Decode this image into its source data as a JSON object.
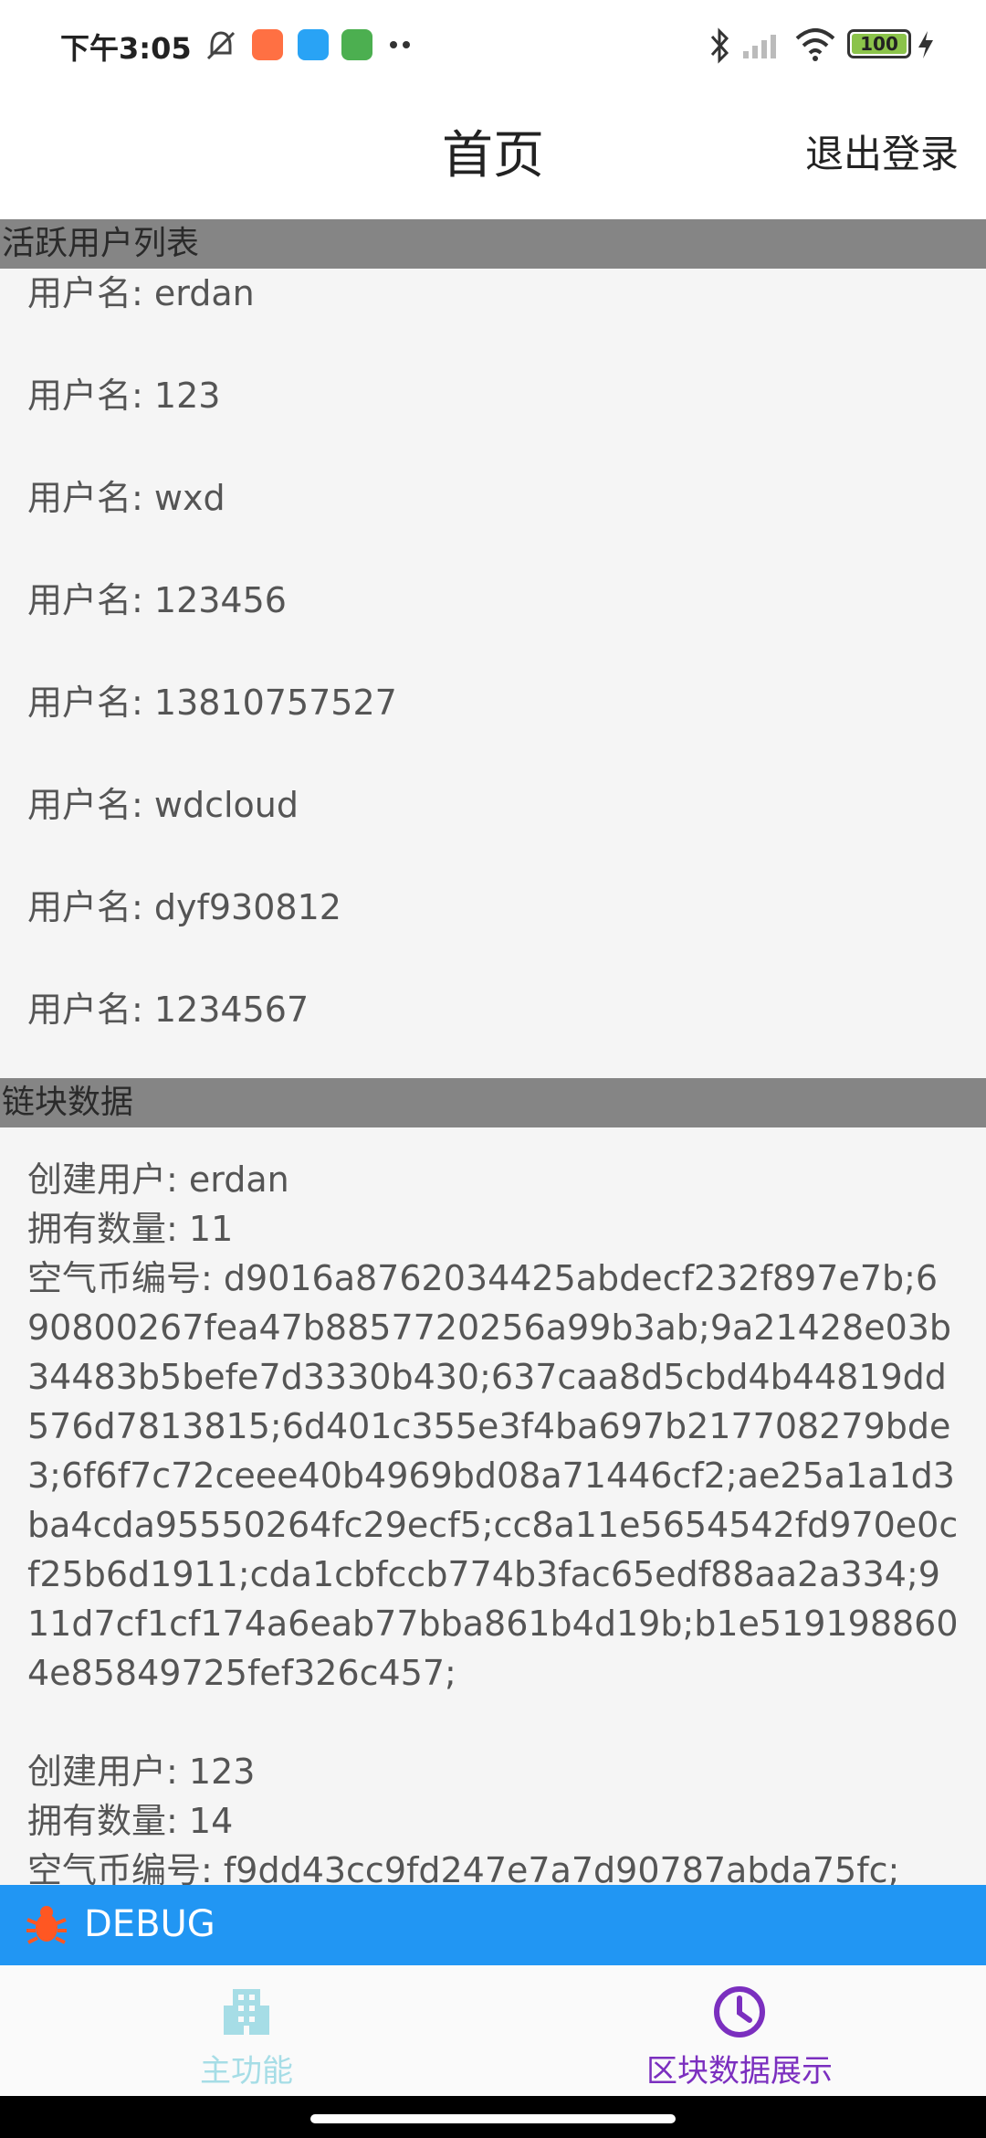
{
  "status_bar": {
    "time": "下午3:05",
    "battery": "100",
    "icons": [
      "mute-icon",
      "app-notification-icon",
      "app-notification-icon",
      "app-notification-icon",
      "more-icon",
      "bluetooth-icon",
      "signal-icon",
      "wifi-icon",
      "battery-icon",
      "charging-icon"
    ]
  },
  "header": {
    "title": "首页",
    "logout_label": "退出登录"
  },
  "active_users": {
    "title": "活跃用户列表",
    "items": [
      {
        "label": "用户名: ",
        "value": "erdan"
      },
      {
        "label": "用户名: ",
        "value": "123"
      },
      {
        "label": "用户名: ",
        "value": "wxd"
      },
      {
        "label": "用户名: ",
        "value": "123456"
      },
      {
        "label": "用户名: ",
        "value": "13810757527"
      },
      {
        "label": "用户名: ",
        "value": "wdcloud"
      },
      {
        "label": "用户名: ",
        "value": "dyf930812"
      },
      {
        "label": "用户名: ",
        "value": "1234567"
      }
    ]
  },
  "chain_data": {
    "title": "链块数据",
    "records": [
      {
        "creator_label": "创建用户: ",
        "creator": "erdan",
        "count_label": "拥有数量: ",
        "count": "11",
        "coins_label": "空气币编号: ",
        "coins": "d9016a8762034425abdecf232f897e7b;690800267fea47b8857720256a99b3ab;9a21428e03b34483b5befe7d3330b430;637caa8d5cbd4b44819dd576d7813815;6d401c355e3f4ba697b217708279bde3;6f6f7c72ceee40b4969bd08a71446cf2;ae25a1a1d3ba4cda95550264fc29ecf5;cc8a11e5654542fd970e0cf25b6d1911;cda1cbfccb774b3fac65edf88aa2a334;911d7cf1cf174a6eab77bba861b4d19b;b1e5191988604e85849725fef326c457;"
      },
      {
        "creator_label": "创建用户: ",
        "creator": "123",
        "count_label": "拥有数量: ",
        "count": "14",
        "coins_label": "空气币编号: ",
        "coins": "f9dd43cc9fd247e7a7d90787abda75fc;"
      }
    ]
  },
  "debug_bar": {
    "label": "DEBUG",
    "color": "#2196f3"
  },
  "bottom_nav": {
    "items": [
      {
        "label": "主功能",
        "icon": "building-icon",
        "active": false,
        "color": "#a6dde6"
      },
      {
        "label": "区块数据展示",
        "icon": "clock-icon",
        "active": true,
        "color": "#7b2fbf"
      }
    ]
  }
}
